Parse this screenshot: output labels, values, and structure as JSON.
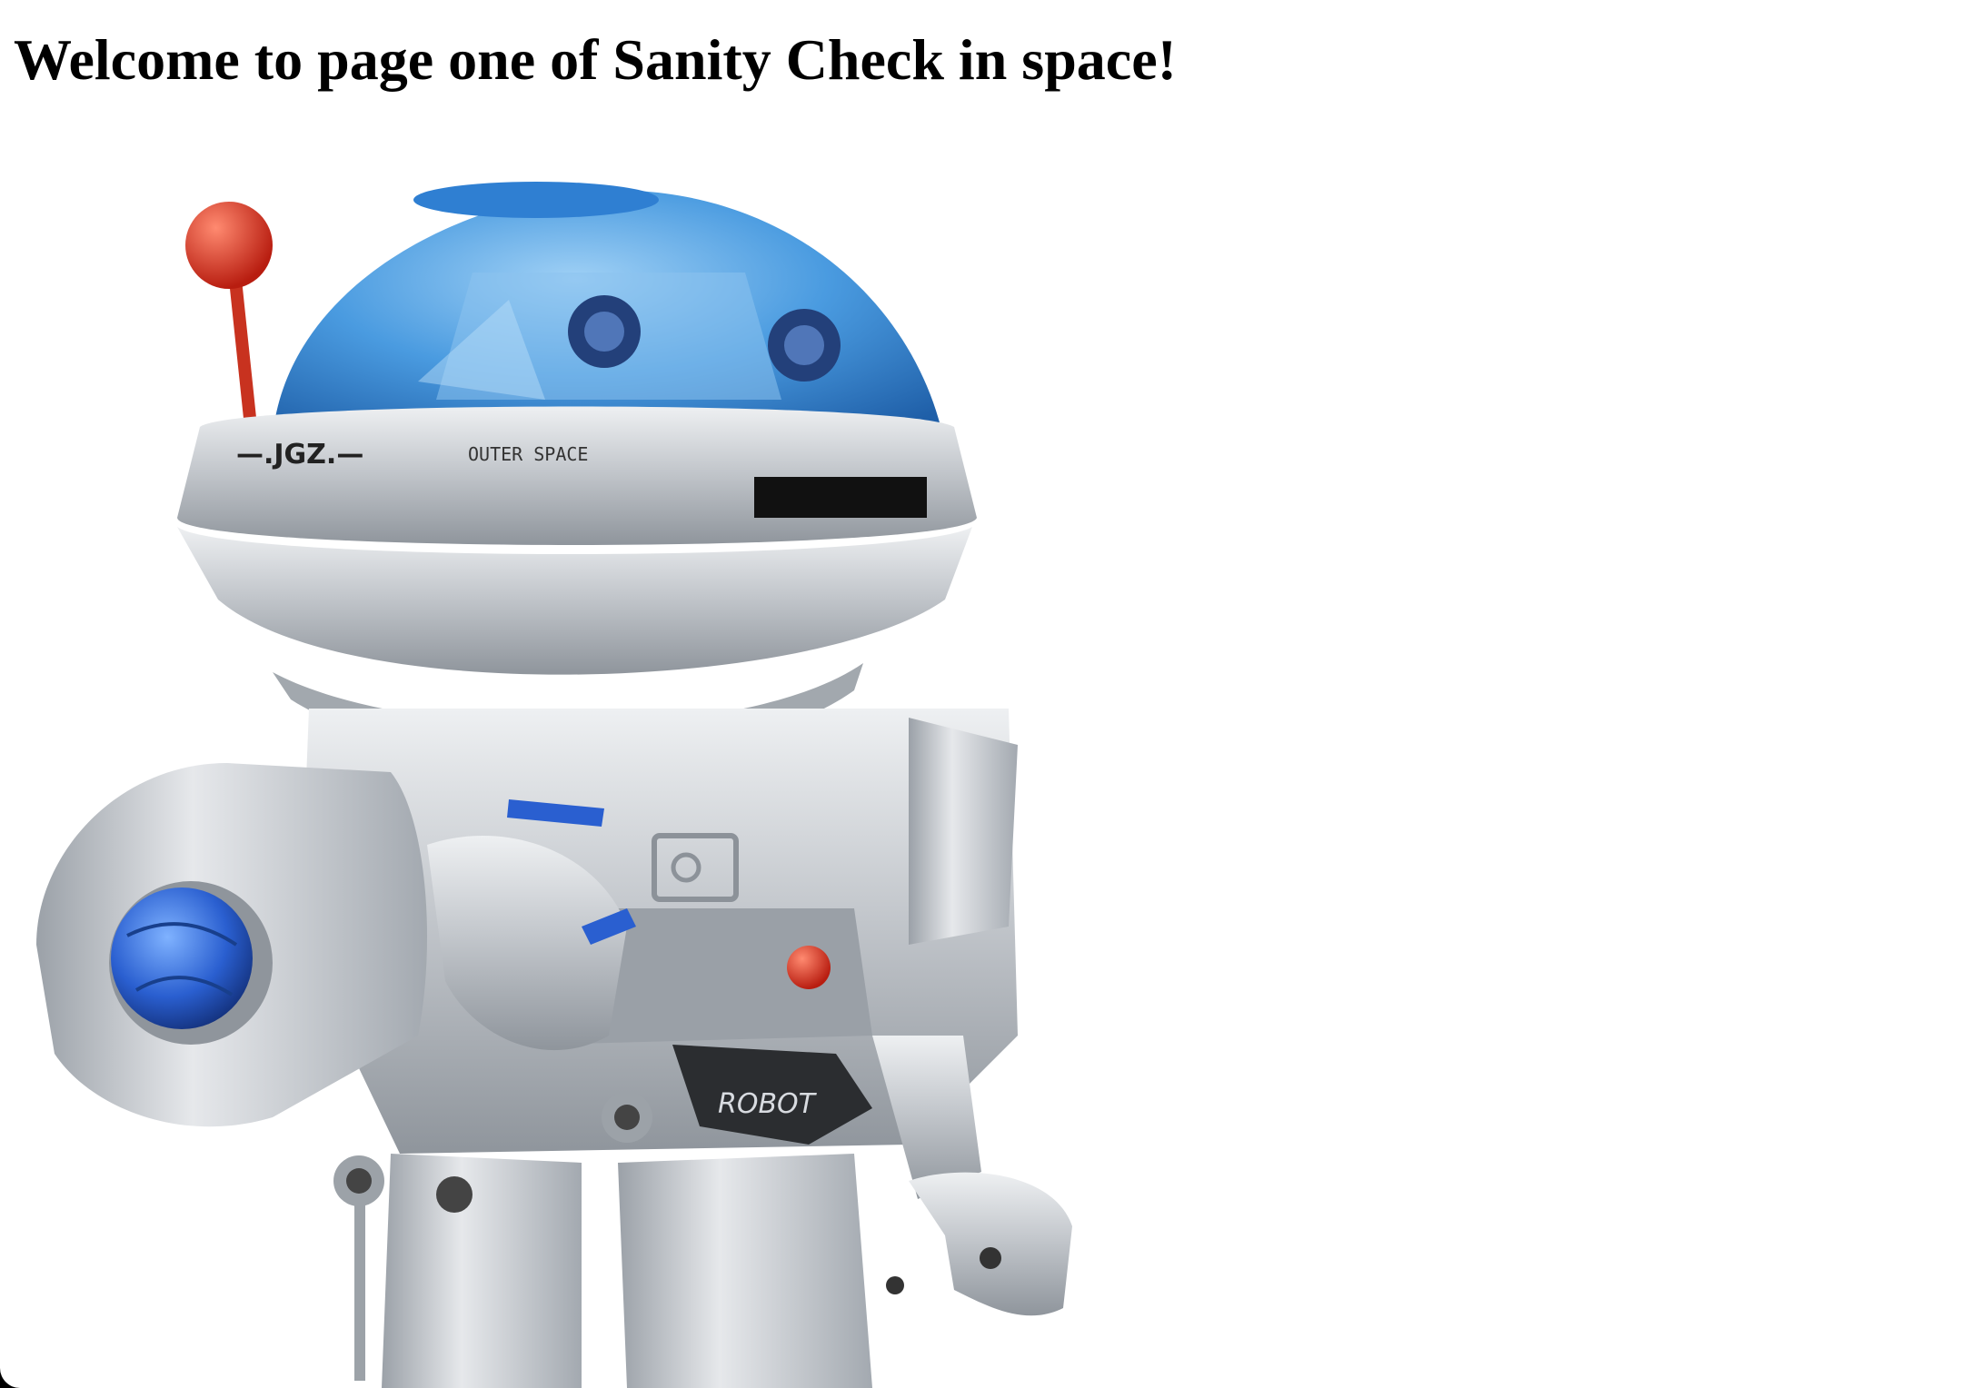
{
  "page": {
    "heading": "Welcome to page one of Sanity Check in space!"
  },
  "robot_image": {
    "alt": "Silver toy robot with blue dome head",
    "head_text": "OUTER SPACE",
    "chest_text": "ROBOT",
    "colors": {
      "silver": "#c9cdd2",
      "dome_blue": "#3a8fd6",
      "antenna_red": "#d8301f",
      "accent_blue": "#2a5fd0"
    }
  }
}
